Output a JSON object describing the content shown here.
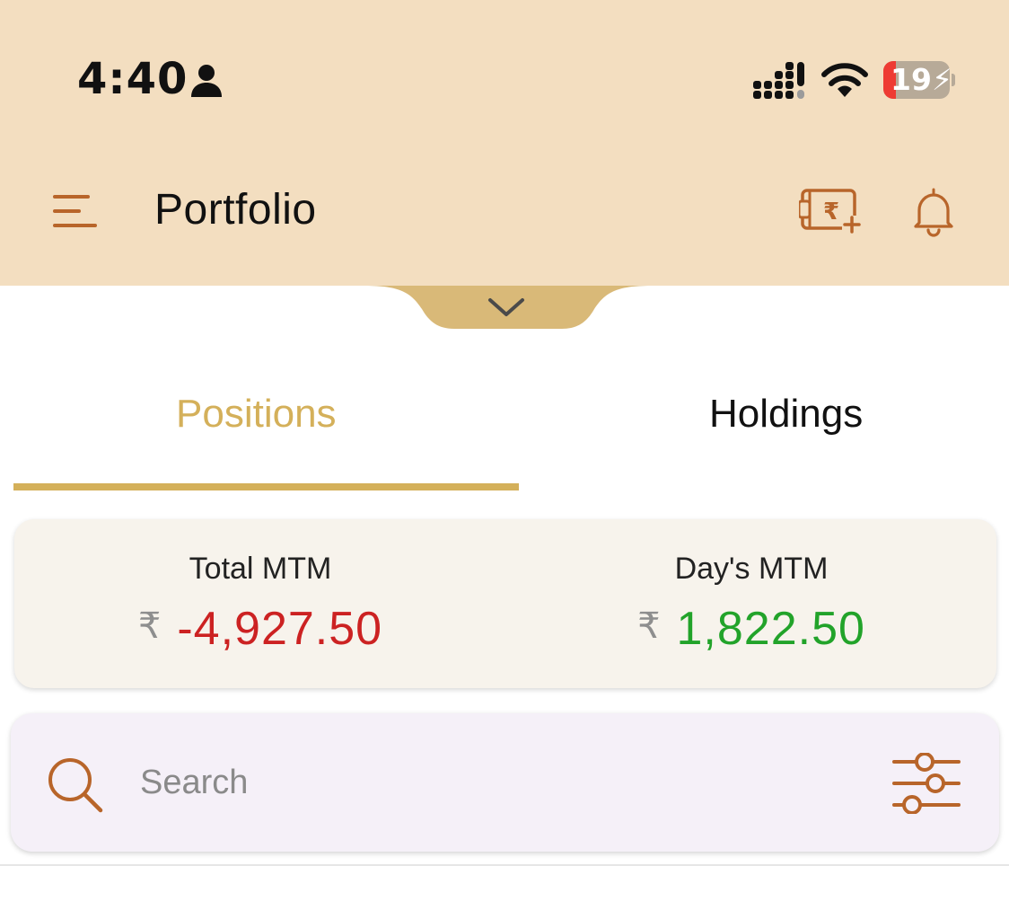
{
  "status_bar": {
    "time": "4:40",
    "battery_level": "19",
    "icons": [
      "person-icon",
      "signal-icon",
      "wifi-icon",
      "battery-icon"
    ]
  },
  "header": {
    "title": "Portfolio",
    "icons": [
      "menu-icon",
      "add-funds-icon",
      "bell-icon"
    ],
    "background": "#f3dec0",
    "accent": "#b8652a"
  },
  "tabs": [
    {
      "label": "Positions",
      "active": true
    },
    {
      "label": "Holdings",
      "active": false
    }
  ],
  "summary": {
    "total_mtm": {
      "label": "Total MTM",
      "currency": "₹",
      "value": "-4,927.50"
    },
    "days_mtm": {
      "label": "Day's MTM",
      "currency": "₹",
      "value": "1,822.50"
    }
  },
  "search": {
    "placeholder": "Search",
    "value": ""
  },
  "colors": {
    "active_tab": "#d4b05a",
    "negative": "#cc2222",
    "positive": "#22a32a"
  }
}
